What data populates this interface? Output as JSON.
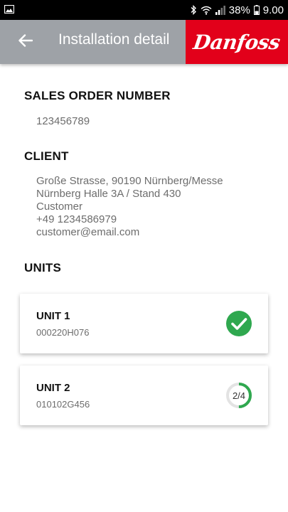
{
  "status_bar": {
    "battery": "38%",
    "time": "9.00",
    "icons": [
      "image-icon",
      "bluetooth-icon",
      "wifi-icon",
      "signal-icon",
      "battery-icon"
    ]
  },
  "app_bar": {
    "title": "Installation detail",
    "back_icon": "arrow-left-icon",
    "brand": "Danfoss",
    "brand_color": "#e2001a",
    "bar_color": "#9ea2a7"
  },
  "sales_order": {
    "heading": "SALES ORDER NUMBER",
    "value": "123456789"
  },
  "client": {
    "heading": "CLIENT",
    "lines": [
      "Große Strasse, 90190 Nürnberg/Messe",
      "Nürnberg Halle 3A / Stand 430",
      "Customer",
      "+49 1234586979",
      "customer@email.com"
    ]
  },
  "units": {
    "heading": "UNITS",
    "items": [
      {
        "name": "UNIT 1",
        "code": "000220H076",
        "status": "complete",
        "status_icon": "check-circle-icon"
      },
      {
        "name": "UNIT 2",
        "code": "010102G456",
        "status": "in-progress",
        "progress_label": "2/4",
        "progress_fraction": 0.5
      }
    ],
    "accent_color": "#2fa84f"
  }
}
